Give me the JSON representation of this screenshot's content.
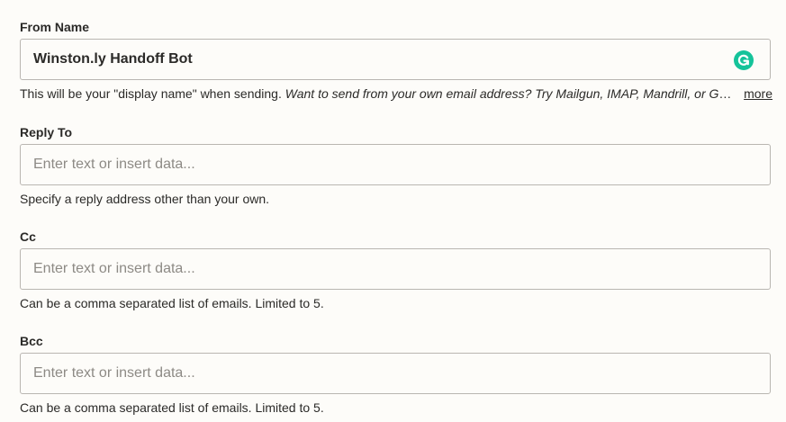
{
  "fields": {
    "from_name": {
      "label": "From Name",
      "value": "Winston.ly Handoff Bot",
      "help_plain": "This will be your \"display name\" when sending. ",
      "help_italic": "Want to send from your own email address? Try Mailgun, IMAP, Mandrill, or Gmail.",
      "more_label": "more"
    },
    "reply_to": {
      "label": "Reply To",
      "placeholder": "Enter text or insert data...",
      "help": "Specify a reply address other than your own."
    },
    "cc": {
      "label": "Cc",
      "placeholder": "Enter text or insert data...",
      "help": "Can be a comma separated list of emails. Limited to 5."
    },
    "bcc": {
      "label": "Bcc",
      "placeholder": "Enter text or insert data...",
      "help": "Can be a comma separated list of emails. Limited to 5."
    }
  },
  "icons": {
    "grammarly": "grammarly-icon"
  },
  "colors": {
    "background": "#fdfcf9",
    "border": "#b9b6b1",
    "placeholder": "#8d8a85",
    "grammarly": "#15c39a"
  }
}
